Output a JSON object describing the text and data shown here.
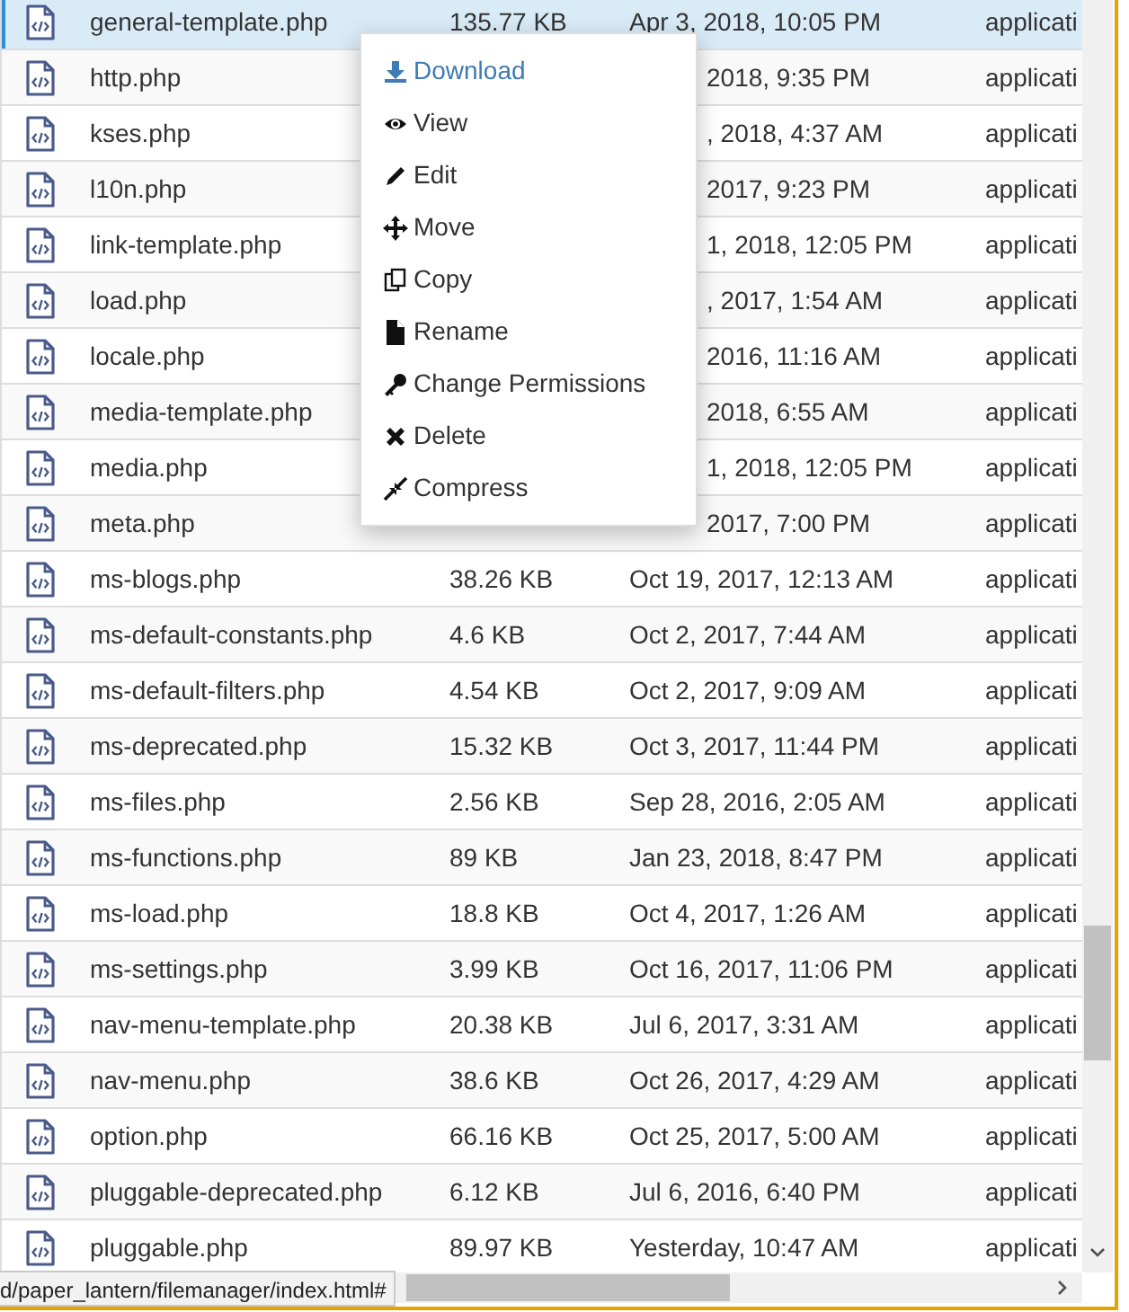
{
  "files": [
    {
      "name": "general-template.php",
      "size": "135.77 KB",
      "modified": "Apr 3, 2018, 10:05 PM",
      "type": "applicati",
      "selected": true
    },
    {
      "name": "http.php",
      "modified": "2018, 9:35 PM",
      "type": "applicati",
      "selected": false
    },
    {
      "name": "kses.php",
      "modified": ", 2018, 4:37 AM",
      "type": "applicati",
      "selected": false
    },
    {
      "name": "l10n.php",
      "modified": "2017, 9:23 PM",
      "type": "applicati",
      "selected": false
    },
    {
      "name": "link-template.php",
      "modified": "1, 2018, 12:05 PM",
      "type": "applicati",
      "selected": false
    },
    {
      "name": "load.php",
      "modified": ", 2017, 1:54 AM",
      "type": "applicati",
      "selected": false
    },
    {
      "name": "locale.php",
      "modified": "2016, 11:16 AM",
      "type": "applicati",
      "selected": false
    },
    {
      "name": "media-template.php",
      "modified": "2018, 6:55 AM",
      "type": "applicati",
      "selected": false
    },
    {
      "name": "media.php",
      "modified": "1, 2018, 12:05 PM",
      "type": "applicati",
      "selected": false
    },
    {
      "name": "meta.php",
      "modified": "2017, 7:00 PM",
      "type": "applicati",
      "selected": false
    },
    {
      "name": "ms-blogs.php",
      "size": "38.26 KB",
      "modified": "Oct 19, 2017, 12:13 AM",
      "type": "applicati",
      "selected": false
    },
    {
      "name": "ms-default-constants.php",
      "size": "4.6 KB",
      "modified": "Oct 2, 2017, 7:44 AM",
      "type": "applicati",
      "selected": false
    },
    {
      "name": "ms-default-filters.php",
      "size": "4.54 KB",
      "modified": "Oct 2, 2017, 9:09 AM",
      "type": "applicati",
      "selected": false
    },
    {
      "name": "ms-deprecated.php",
      "size": "15.32 KB",
      "modified": "Oct 3, 2017, 11:44 PM",
      "type": "applicati",
      "selected": false
    },
    {
      "name": "ms-files.php",
      "size": "2.56 KB",
      "modified": "Sep 28, 2016, 2:05 AM",
      "type": "applicati",
      "selected": false
    },
    {
      "name": "ms-functions.php",
      "size": "89 KB",
      "modified": "Jan 23, 2018, 8:47 PM",
      "type": "applicati",
      "selected": false
    },
    {
      "name": "ms-load.php",
      "size": "18.8 KB",
      "modified": "Oct 4, 2017, 1:26 AM",
      "type": "applicati",
      "selected": false
    },
    {
      "name": "ms-settings.php",
      "size": "3.99 KB",
      "modified": "Oct 16, 2017, 11:06 PM",
      "type": "applicati",
      "selected": false
    },
    {
      "name": "nav-menu-template.php",
      "size": "20.38 KB",
      "modified": "Jul 6, 2017, 3:31 AM",
      "type": "applicati",
      "selected": false
    },
    {
      "name": "nav-menu.php",
      "size": "38.6 KB",
      "modified": "Oct 26, 2017, 4:29 AM",
      "type": "applicati",
      "selected": false
    },
    {
      "name": "option.php",
      "size": "66.16 KB",
      "modified": "Oct 25, 2017, 5:00 AM",
      "type": "applicati",
      "selected": false
    },
    {
      "name": "pluggable-deprecated.php",
      "size": "6.12 KB",
      "modified": "Jul 6, 2016, 6:40 PM",
      "type": "applicati",
      "selected": false
    },
    {
      "name": "pluggable.php",
      "size": "89.97 KB",
      "modified": "Yesterday, 10:47 AM",
      "type": "applicati",
      "selected": false
    }
  ],
  "context_menu": {
    "items": [
      {
        "kind": "download",
        "label": "Download",
        "selected": true
      },
      {
        "kind": "view",
        "label": "View",
        "selected": false
      },
      {
        "kind": "edit",
        "label": "Edit",
        "selected": false
      },
      {
        "kind": "move",
        "label": "Move",
        "selected": false
      },
      {
        "kind": "copy",
        "label": "Copy",
        "selected": false
      },
      {
        "kind": "rename",
        "label": "Rename",
        "selected": false
      },
      {
        "kind": "permissions",
        "label": "Change Permissions",
        "selected": false
      },
      {
        "kind": "delete",
        "label": "Delete",
        "selected": false
      },
      {
        "kind": "compress",
        "label": "Compress",
        "selected": false
      }
    ]
  },
  "status_url": "d/paper_lantern/filemanager/index.html#"
}
